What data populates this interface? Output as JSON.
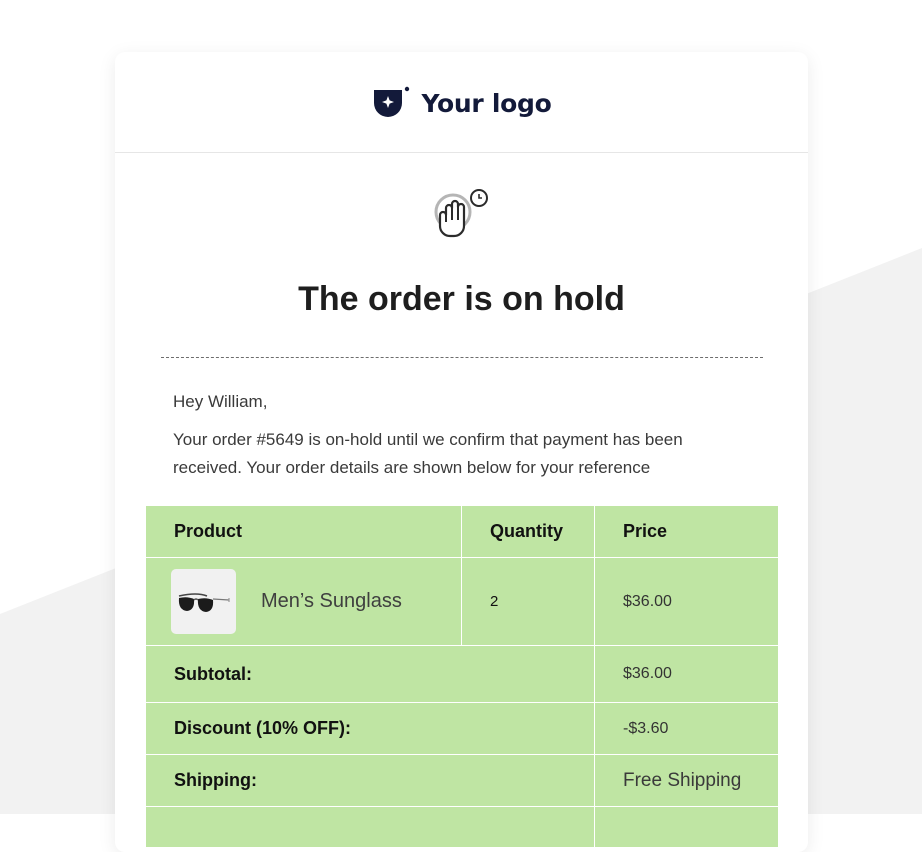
{
  "brand": {
    "logo_text": "Your logo"
  },
  "hero": {
    "icon": "hand-hold-clock-icon",
    "title": "The order is on hold"
  },
  "body": {
    "greeting": "Hey William,",
    "message": "Your order #5649 is on-hold until we confirm that payment has been received. Your order details are shown below for your reference"
  },
  "order_table": {
    "headers": {
      "product": "Product",
      "quantity": "Quantity",
      "price": "Price"
    },
    "items": [
      {
        "name": "Men’s Sunglass",
        "quantity": "2",
        "price": "$36.00",
        "image": "sunglasses-icon"
      }
    ],
    "summary": {
      "subtotal_label": "Subtotal:",
      "subtotal_value": "$36.00",
      "discount_label": "Discount (10% OFF):",
      "discount_value": "-$3.60",
      "shipping_label": "Shipping:",
      "shipping_value": "Free Shipping"
    }
  },
  "colors": {
    "table_bg": "#bfe5a3",
    "brand_navy": "#131a3a",
    "page_shape": "#f2f2f2"
  }
}
